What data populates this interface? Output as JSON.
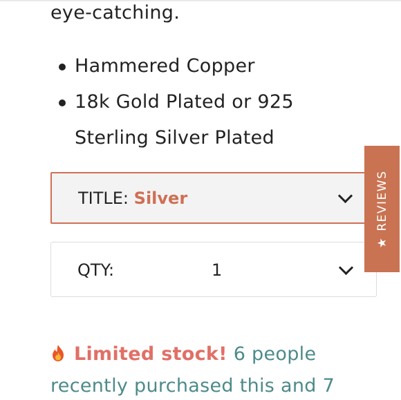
{
  "description": {
    "intro_text": "eye-catching.",
    "features": [
      "Hammered Copper",
      "18k Gold Plated or 925",
      "Sterling Silver Plated"
    ]
  },
  "title_select": {
    "label": "TITLE:",
    "value": "Silver",
    "icon": "chevron-down-icon"
  },
  "qty_select": {
    "label": "QTY:",
    "value": "1",
    "icon": "chevron-down-icon"
  },
  "reviews_tab": {
    "star": "★",
    "label": "REVIEWS",
    "color": "#c97352"
  },
  "stock_notice": {
    "icon": "fire-icon",
    "strong": "Limited stock!",
    "text": "6 people recently purchased this and 7"
  },
  "colors": {
    "accent": "#cf6f55",
    "teal_text": "#4d8a8a",
    "alert_text": "#e07067"
  }
}
